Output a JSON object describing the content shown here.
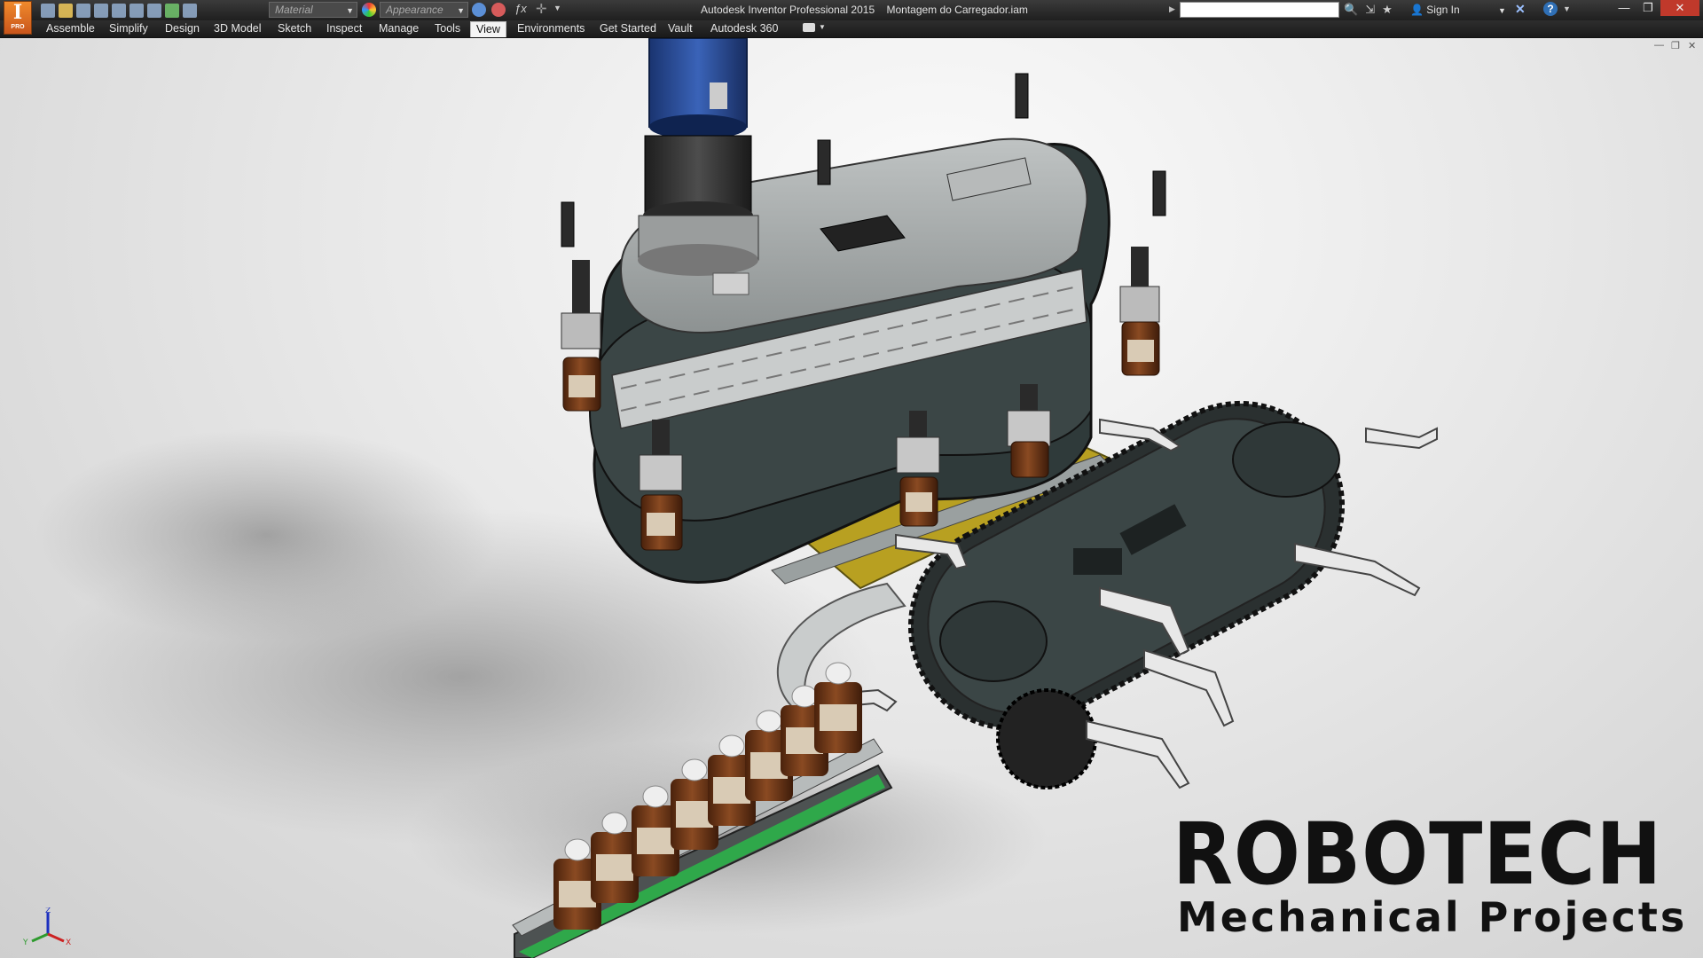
{
  "app": {
    "badge_letter": "I",
    "badge_text": "PRO",
    "title": "Autodesk Inventor Professional 2015",
    "document": "Montagem do Carregador.iam"
  },
  "quick_access": {
    "material_placeholder": "Material",
    "appearance_placeholder": "Appearance"
  },
  "search": {
    "value": ""
  },
  "account": {
    "sign_in": "Sign In"
  },
  "window_controls": {
    "minimize": "—",
    "restore": "❐",
    "close": "✕"
  },
  "ribbon": {
    "tabs": [
      {
        "label": "Assemble"
      },
      {
        "label": "Simplify"
      },
      {
        "label": "Design"
      },
      {
        "label": "3D Model"
      },
      {
        "label": "Sketch"
      },
      {
        "label": "Inspect"
      },
      {
        "label": "Manage"
      },
      {
        "label": "Tools"
      },
      {
        "label": "View"
      },
      {
        "label": "Environments"
      },
      {
        "label": "Get Started"
      },
      {
        "label": "Vault"
      },
      {
        "label": "Autodesk 360"
      }
    ],
    "active_tab": "View"
  },
  "viewport": {
    "axis_labels": {
      "x": "X",
      "y": "Y",
      "z": "Z"
    }
  },
  "branding": {
    "title": "ROBOTECH",
    "subtitle": "Mechanical Projects"
  },
  "colors": {
    "accent": "#f08a2c",
    "machine_dark": "#3b4646",
    "motor_blue": "#1f3f82",
    "conveyor_yellow": "#b8a021",
    "belt_green": "#2fa84a",
    "bottle_amber": "#6b3416"
  }
}
